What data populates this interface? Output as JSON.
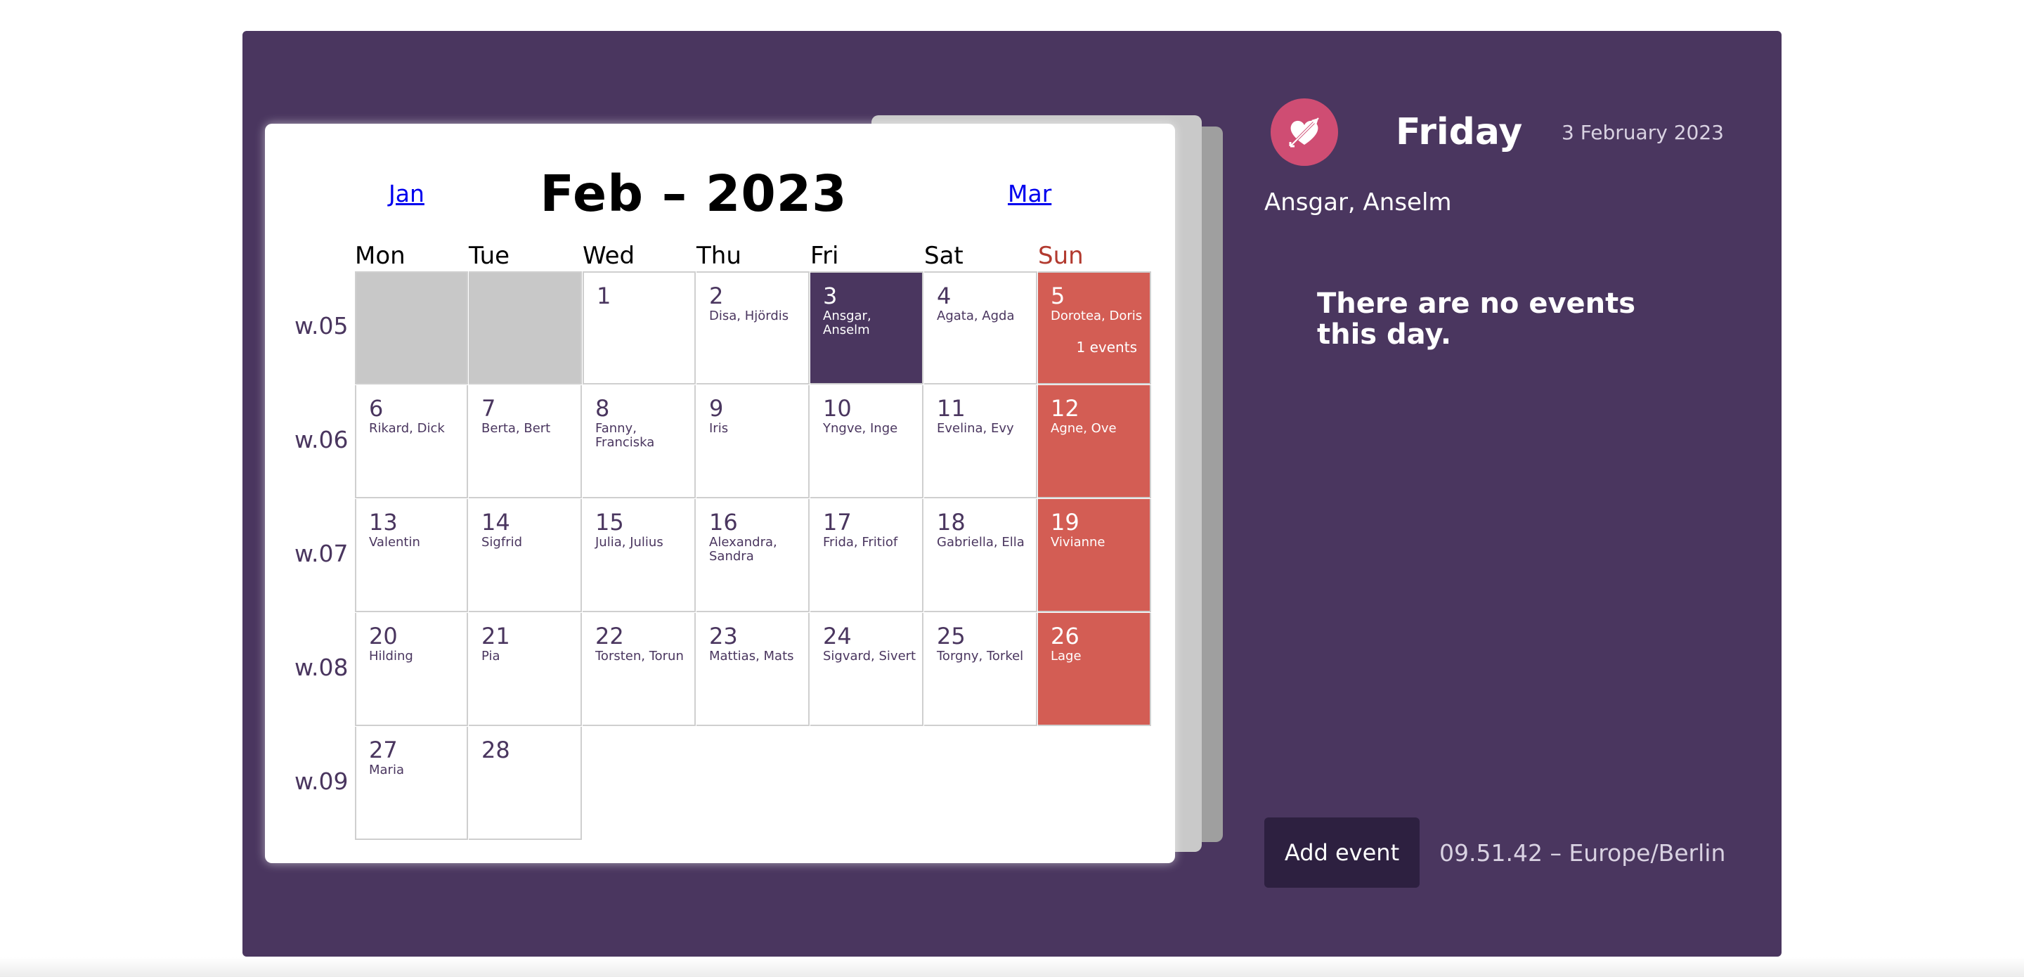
{
  "calendar": {
    "month_title": "Feb – 2023",
    "prev_month": "Jan",
    "next_month": "Mar",
    "weekdays": [
      "Mon",
      "Tue",
      "Wed",
      "Thu",
      "Fri",
      "Sat",
      "Sun"
    ],
    "weeks": [
      {
        "label": "w.05",
        "days": [
          {
            "empty": true
          },
          {
            "empty": true
          },
          {
            "day": "1",
            "names": ""
          },
          {
            "day": "2",
            "names": "Disa, Hjördis"
          },
          {
            "day": "3",
            "names": "Ansgar, Anselm",
            "selected": true
          },
          {
            "day": "4",
            "names": "Agata, Agda"
          },
          {
            "day": "5",
            "names": "Dorotea, Doris",
            "events": "1 events"
          }
        ]
      },
      {
        "label": "w.06",
        "days": [
          {
            "day": "6",
            "names": "Rikard, Dick"
          },
          {
            "day": "7",
            "names": "Berta, Bert"
          },
          {
            "day": "8",
            "names": "Fanny, Franciska"
          },
          {
            "day": "9",
            "names": "Iris"
          },
          {
            "day": "10",
            "names": "Yngve, Inge"
          },
          {
            "day": "11",
            "names": "Evelina, Evy"
          },
          {
            "day": "12",
            "names": "Agne, Ove"
          }
        ]
      },
      {
        "label": "w.07",
        "days": [
          {
            "day": "13",
            "names": "Valentin"
          },
          {
            "day": "14",
            "names": "Sigfrid"
          },
          {
            "day": "15",
            "names": "Julia, Julius"
          },
          {
            "day": "16",
            "names": "Alexandra, Sandra"
          },
          {
            "day": "17",
            "names": "Frida, Fritiof"
          },
          {
            "day": "18",
            "names": "Gabriella, Ella"
          },
          {
            "day": "19",
            "names": "Vivianne"
          }
        ]
      },
      {
        "label": "w.08",
        "days": [
          {
            "day": "20",
            "names": "Hilding"
          },
          {
            "day": "21",
            "names": "Pia"
          },
          {
            "day": "22",
            "names": "Torsten, Torun"
          },
          {
            "day": "23",
            "names": "Mattias, Mats"
          },
          {
            "day": "24",
            "names": "Sigvard, Sivert"
          },
          {
            "day": "25",
            "names": "Torgny, Torkel"
          },
          {
            "day": "26",
            "names": "Lage"
          }
        ]
      },
      {
        "label": "w.09",
        "days": [
          {
            "day": "27",
            "names": "Maria"
          },
          {
            "day": "28",
            "names": ""
          }
        ]
      }
    ]
  },
  "panel": {
    "icon": "heart-arrow-icon",
    "weekday": "Friday",
    "date": "3 February 2023",
    "names": "Ansgar, Anselm",
    "empty_message": "There are no events this day.",
    "add_event_label": "Add event",
    "clock": "09.51.42 – Europe/Berlin"
  },
  "colors": {
    "primary": "#4a365f",
    "sunday": "#d35d54",
    "empty_day": "#c8c8c8",
    "icon_bg": "#cf4d73"
  }
}
